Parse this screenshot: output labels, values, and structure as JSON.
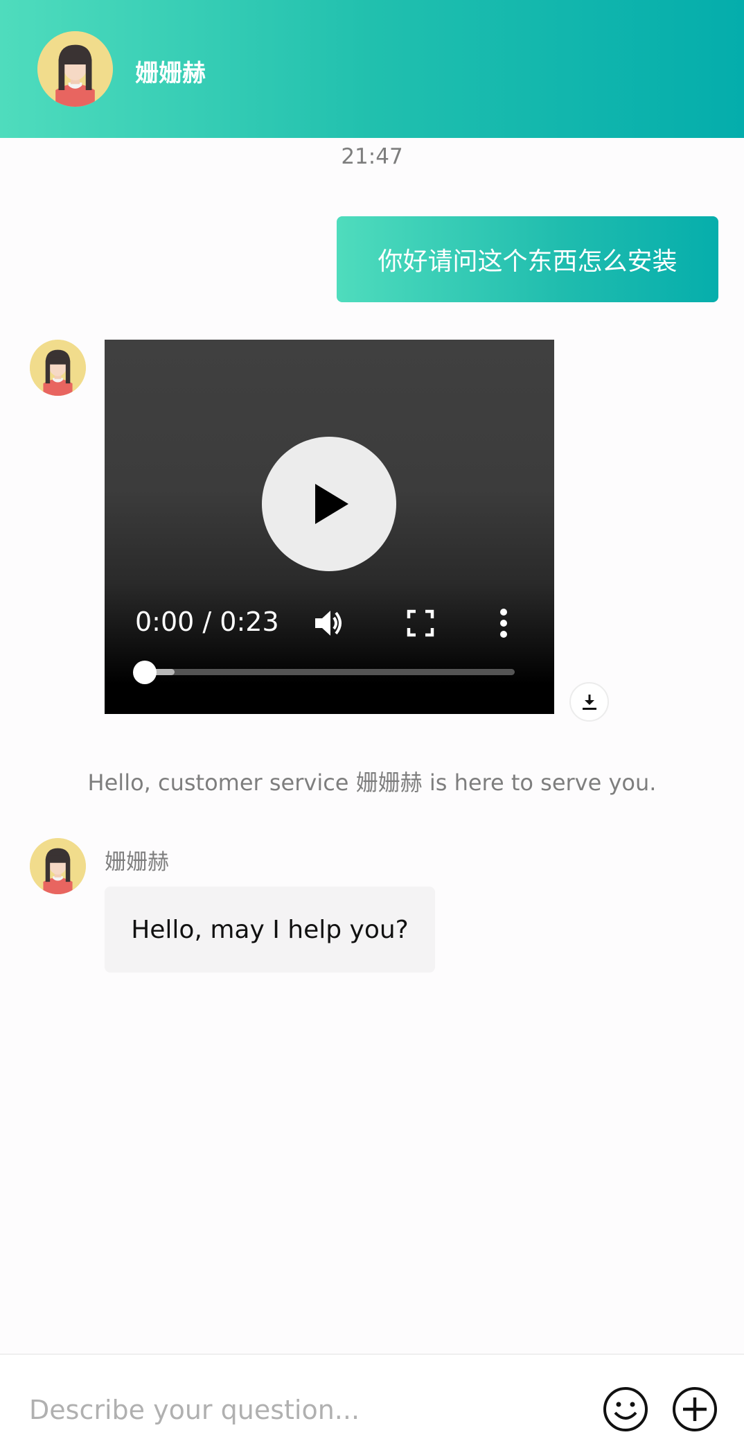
{
  "header": {
    "name": "姗姗赫",
    "avatar_icon": "girl-avatar-icon",
    "gradient_start": "#4fdcbd",
    "gradient_end": "#04adac"
  },
  "chat": {
    "timestamp": "21:47",
    "outgoing_message": "你好请问这个东西怎么安装",
    "video": {
      "time_display": "0:00 / 0:23",
      "current_time": "0:00",
      "duration": "0:23",
      "progress_fraction": 0,
      "buffered_fraction": 0.08,
      "icons": [
        "play-icon",
        "volume-icon",
        "fullscreen-icon",
        "more-options-icon",
        "download-icon"
      ]
    },
    "system_message": "Hello, customer service 姗姗赫 is here to serve you.",
    "incoming": {
      "sender": "姗姗赫",
      "message": "Hello, may I help you?"
    }
  },
  "footer": {
    "input_placeholder": "Describe your question...",
    "input_value": "",
    "icons": [
      "emoji-icon",
      "add-icon"
    ]
  }
}
